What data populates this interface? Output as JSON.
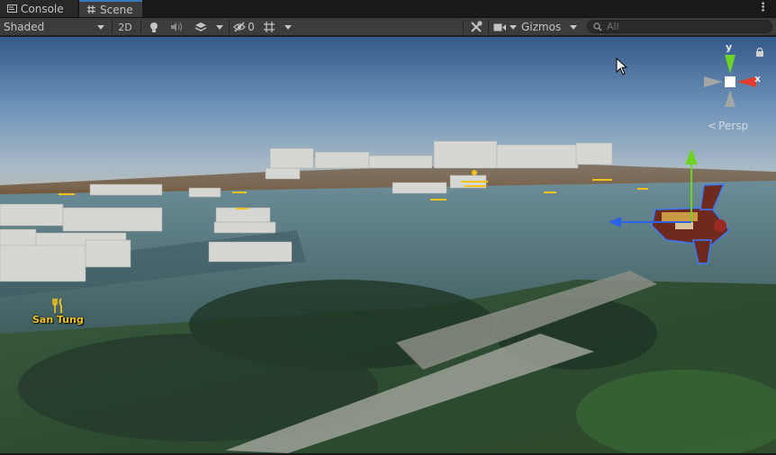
{
  "tabs": [
    {
      "label": "Console",
      "icon": "console-icon"
    },
    {
      "label": "Scene",
      "icon": "scene-hash-icon",
      "active": true
    }
  ],
  "toolbar": {
    "shading_mode": "Shaded",
    "mode_2d": "2D",
    "hidden_count": "0",
    "gizmos_label": "Gizmos",
    "search_placeholder": "All"
  },
  "scene": {
    "poi_label": "San Tung",
    "poi_icon": "restaurant-icon"
  },
  "gizmo": {
    "axis_y": "y",
    "axis_x": "x",
    "projection": "Persp"
  },
  "colors": {
    "active_tab_accent": "#3a79bb",
    "poi_label": "#f2c21b",
    "axis_x": "#e23c2c",
    "axis_y": "#6dd326",
    "axis_z": "#2a63e8"
  }
}
